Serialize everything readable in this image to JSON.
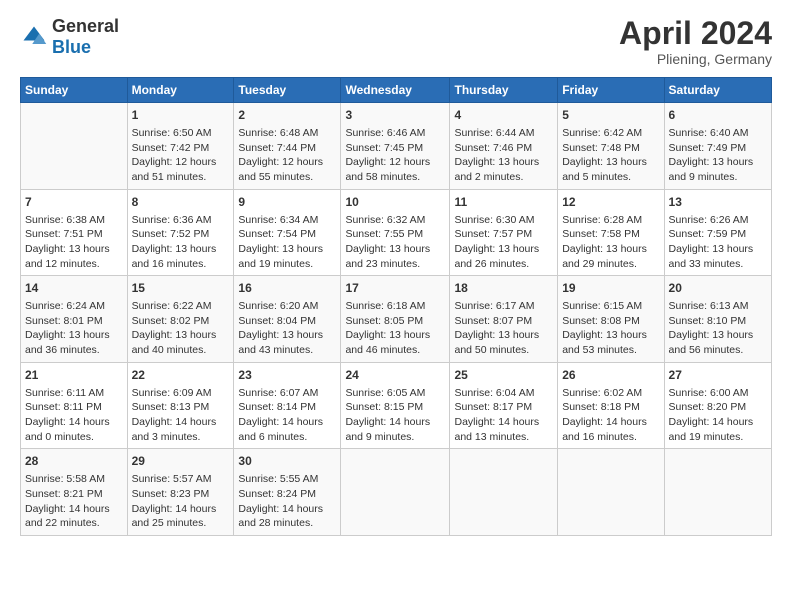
{
  "header": {
    "logo_general": "General",
    "logo_blue": "Blue",
    "month_title": "April 2024",
    "location": "Pliening, Germany"
  },
  "days_of_week": [
    "Sunday",
    "Monday",
    "Tuesday",
    "Wednesday",
    "Thursday",
    "Friday",
    "Saturday"
  ],
  "weeks": [
    [
      {
        "day": "",
        "info": ""
      },
      {
        "day": "1",
        "info": "Sunrise: 6:50 AM\nSunset: 7:42 PM\nDaylight: 12 hours\nand 51 minutes."
      },
      {
        "day": "2",
        "info": "Sunrise: 6:48 AM\nSunset: 7:44 PM\nDaylight: 12 hours\nand 55 minutes."
      },
      {
        "day": "3",
        "info": "Sunrise: 6:46 AM\nSunset: 7:45 PM\nDaylight: 12 hours\nand 58 minutes."
      },
      {
        "day": "4",
        "info": "Sunrise: 6:44 AM\nSunset: 7:46 PM\nDaylight: 13 hours\nand 2 minutes."
      },
      {
        "day": "5",
        "info": "Sunrise: 6:42 AM\nSunset: 7:48 PM\nDaylight: 13 hours\nand 5 minutes."
      },
      {
        "day": "6",
        "info": "Sunrise: 6:40 AM\nSunset: 7:49 PM\nDaylight: 13 hours\nand 9 minutes."
      }
    ],
    [
      {
        "day": "7",
        "info": "Sunrise: 6:38 AM\nSunset: 7:51 PM\nDaylight: 13 hours\nand 12 minutes."
      },
      {
        "day": "8",
        "info": "Sunrise: 6:36 AM\nSunset: 7:52 PM\nDaylight: 13 hours\nand 16 minutes."
      },
      {
        "day": "9",
        "info": "Sunrise: 6:34 AM\nSunset: 7:54 PM\nDaylight: 13 hours\nand 19 minutes."
      },
      {
        "day": "10",
        "info": "Sunrise: 6:32 AM\nSunset: 7:55 PM\nDaylight: 13 hours\nand 23 minutes."
      },
      {
        "day": "11",
        "info": "Sunrise: 6:30 AM\nSunset: 7:57 PM\nDaylight: 13 hours\nand 26 minutes."
      },
      {
        "day": "12",
        "info": "Sunrise: 6:28 AM\nSunset: 7:58 PM\nDaylight: 13 hours\nand 29 minutes."
      },
      {
        "day": "13",
        "info": "Sunrise: 6:26 AM\nSunset: 7:59 PM\nDaylight: 13 hours\nand 33 minutes."
      }
    ],
    [
      {
        "day": "14",
        "info": "Sunrise: 6:24 AM\nSunset: 8:01 PM\nDaylight: 13 hours\nand 36 minutes."
      },
      {
        "day": "15",
        "info": "Sunrise: 6:22 AM\nSunset: 8:02 PM\nDaylight: 13 hours\nand 40 minutes."
      },
      {
        "day": "16",
        "info": "Sunrise: 6:20 AM\nSunset: 8:04 PM\nDaylight: 13 hours\nand 43 minutes."
      },
      {
        "day": "17",
        "info": "Sunrise: 6:18 AM\nSunset: 8:05 PM\nDaylight: 13 hours\nand 46 minutes."
      },
      {
        "day": "18",
        "info": "Sunrise: 6:17 AM\nSunset: 8:07 PM\nDaylight: 13 hours\nand 50 minutes."
      },
      {
        "day": "19",
        "info": "Sunrise: 6:15 AM\nSunset: 8:08 PM\nDaylight: 13 hours\nand 53 minutes."
      },
      {
        "day": "20",
        "info": "Sunrise: 6:13 AM\nSunset: 8:10 PM\nDaylight: 13 hours\nand 56 minutes."
      }
    ],
    [
      {
        "day": "21",
        "info": "Sunrise: 6:11 AM\nSunset: 8:11 PM\nDaylight: 14 hours\nand 0 minutes."
      },
      {
        "day": "22",
        "info": "Sunrise: 6:09 AM\nSunset: 8:13 PM\nDaylight: 14 hours\nand 3 minutes."
      },
      {
        "day": "23",
        "info": "Sunrise: 6:07 AM\nSunset: 8:14 PM\nDaylight: 14 hours\nand 6 minutes."
      },
      {
        "day": "24",
        "info": "Sunrise: 6:05 AM\nSunset: 8:15 PM\nDaylight: 14 hours\nand 9 minutes."
      },
      {
        "day": "25",
        "info": "Sunrise: 6:04 AM\nSunset: 8:17 PM\nDaylight: 14 hours\nand 13 minutes."
      },
      {
        "day": "26",
        "info": "Sunrise: 6:02 AM\nSunset: 8:18 PM\nDaylight: 14 hours\nand 16 minutes."
      },
      {
        "day": "27",
        "info": "Sunrise: 6:00 AM\nSunset: 8:20 PM\nDaylight: 14 hours\nand 19 minutes."
      }
    ],
    [
      {
        "day": "28",
        "info": "Sunrise: 5:58 AM\nSunset: 8:21 PM\nDaylight: 14 hours\nand 22 minutes."
      },
      {
        "day": "29",
        "info": "Sunrise: 5:57 AM\nSunset: 8:23 PM\nDaylight: 14 hours\nand 25 minutes."
      },
      {
        "day": "30",
        "info": "Sunrise: 5:55 AM\nSunset: 8:24 PM\nDaylight: 14 hours\nand 28 minutes."
      },
      {
        "day": "",
        "info": ""
      },
      {
        "day": "",
        "info": ""
      },
      {
        "day": "",
        "info": ""
      },
      {
        "day": "",
        "info": ""
      }
    ]
  ]
}
